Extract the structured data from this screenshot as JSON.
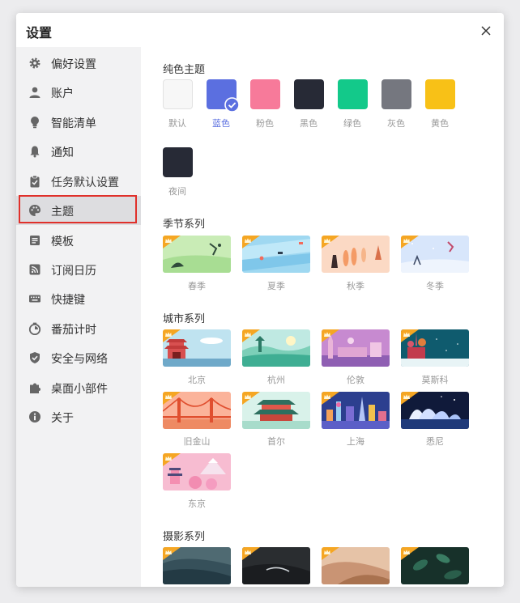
{
  "dialog": {
    "title": "设置"
  },
  "sidebar": {
    "items": [
      {
        "label": "偏好设置",
        "icon": "gear-icon"
      },
      {
        "label": "账户",
        "icon": "user-icon"
      },
      {
        "label": "智能清单",
        "icon": "lightbulb-icon"
      },
      {
        "label": "通知",
        "icon": "bell-icon"
      },
      {
        "label": "任务默认设置",
        "icon": "clipboard-icon"
      },
      {
        "label": "主题",
        "icon": "palette-icon"
      },
      {
        "label": "模板",
        "icon": "template-icon"
      },
      {
        "label": "订阅日历",
        "icon": "rss-icon"
      },
      {
        "label": "快捷键",
        "icon": "keyboard-icon"
      },
      {
        "label": "番茄计时",
        "icon": "timer-icon"
      },
      {
        "label": "安全与网络",
        "icon": "shield-icon"
      },
      {
        "label": "桌面小部件",
        "icon": "puzzle-icon"
      },
      {
        "label": "关于",
        "icon": "info-icon"
      }
    ],
    "active": "主题"
  },
  "themes": {
    "solid": {
      "title": "纯色主题",
      "items": [
        {
          "label": "默认",
          "color": "#f7f7f7"
        },
        {
          "label": "蓝色",
          "color": "#5b6fe0",
          "selected": true
        },
        {
          "label": "粉色",
          "color": "#f77a9a"
        },
        {
          "label": "黑色",
          "color": "#272a36"
        },
        {
          "label": "绿色",
          "color": "#13c98a"
        },
        {
          "label": "灰色",
          "color": "#75777f"
        },
        {
          "label": "黄色",
          "color": "#f8c117"
        },
        {
          "label": "夜间",
          "color": "#272a36"
        }
      ]
    },
    "seasons": {
      "title": "季节系列",
      "items": [
        {
          "label": "春季"
        },
        {
          "label": "夏季"
        },
        {
          "label": "秋季"
        },
        {
          "label": "冬季"
        }
      ]
    },
    "cities": {
      "title": "城市系列",
      "items": [
        {
          "label": "北京"
        },
        {
          "label": "杭州"
        },
        {
          "label": "伦敦"
        },
        {
          "label": "莫斯科"
        },
        {
          "label": "旧金山"
        },
        {
          "label": "首尔"
        },
        {
          "label": "上海"
        },
        {
          "label": "悉尼"
        },
        {
          "label": "东京"
        }
      ]
    },
    "photos": {
      "title": "摄影系列"
    }
  },
  "colors": {
    "accent": "#5b6fe0",
    "highlight_border": "#e0302a",
    "crown": "#f5a623"
  }
}
